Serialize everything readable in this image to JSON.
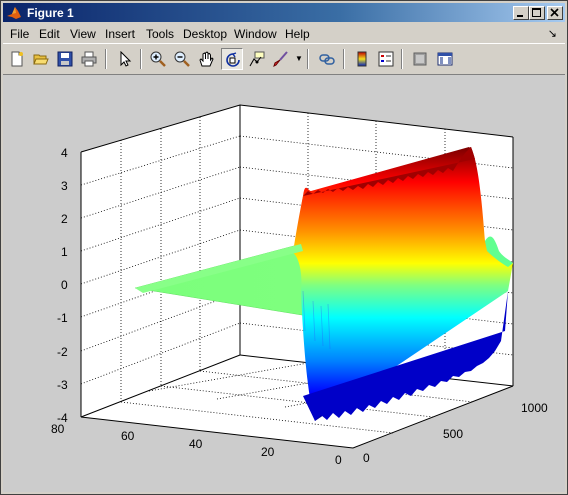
{
  "window": {
    "title": "Figure 1"
  },
  "menu": {
    "items": [
      "File",
      "Edit",
      "View",
      "Insert",
      "Tools",
      "Desktop",
      "Window",
      "Help"
    ]
  },
  "toolbar": {
    "buttons": [
      "new-figure-icon",
      "open-file-icon",
      "save-icon",
      "print-icon",
      "select-arrow-icon",
      "zoom-in-icon",
      "zoom-out-icon",
      "pan-hand-icon",
      "rotate-3d-icon",
      "data-cursor-icon",
      "brush-icon",
      "link-plot-icon",
      "colorbar-icon",
      "legend-icon",
      "hide-plot-tools-icon",
      "show-plot-tools-icon"
    ]
  },
  "chart_data": {
    "type": "surface",
    "colormap": "jet",
    "grid": true,
    "z_ticks": [
      "4",
      "3",
      "2",
      "1",
      "0",
      "-1",
      "-2",
      "-3",
      "-4"
    ],
    "x_ticks": [
      "0",
      "20",
      "40",
      "60",
      "80"
    ],
    "y_ticks": [
      "0",
      "500",
      "1000"
    ],
    "xlim": [
      0,
      80
    ],
    "ylim": [
      0,
      1000
    ],
    "zlim": [
      -4,
      4
    ]
  }
}
